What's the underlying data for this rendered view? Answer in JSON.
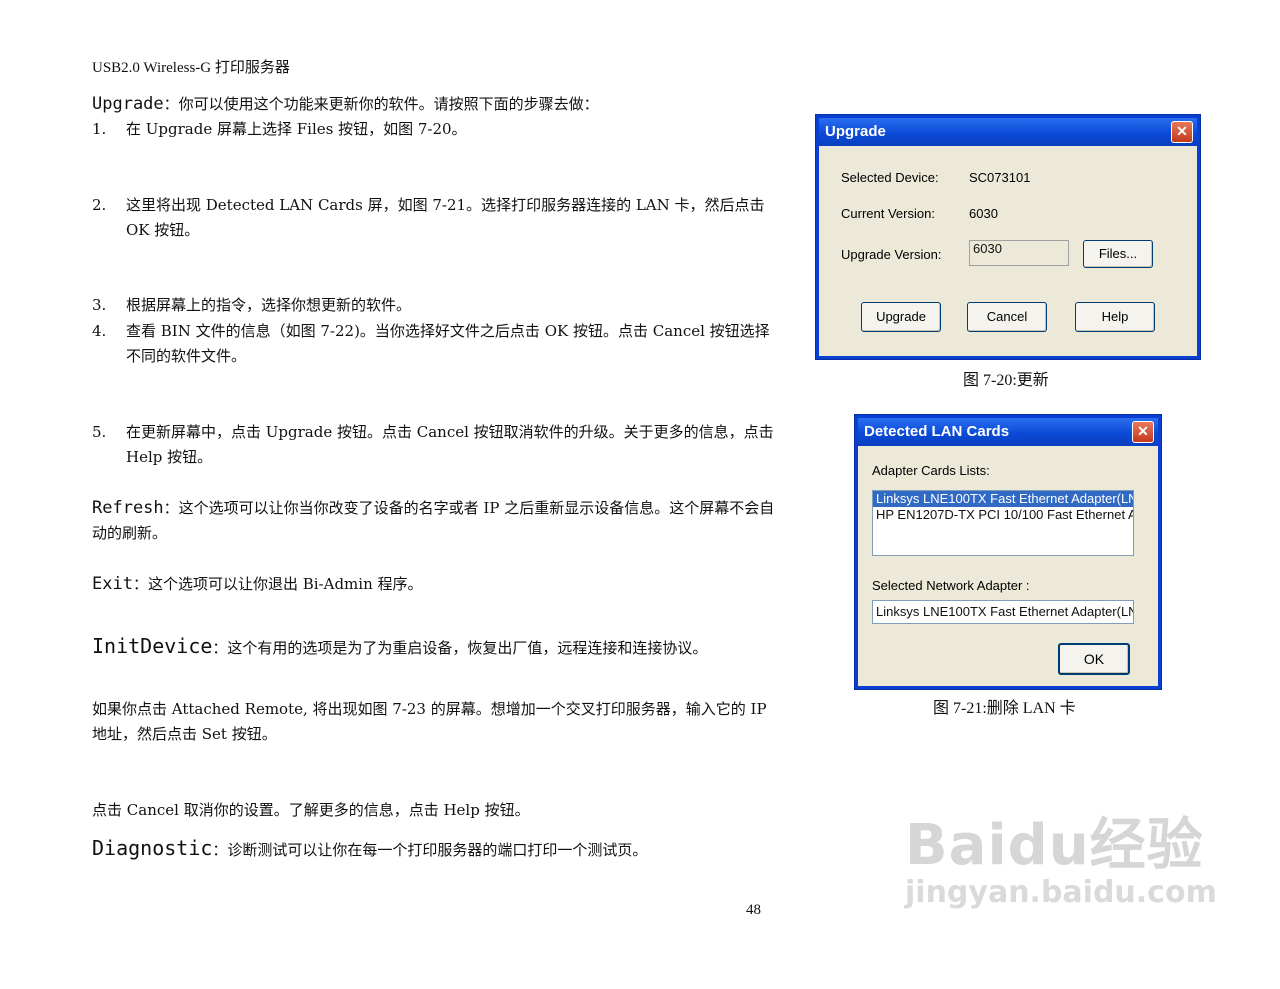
{
  "header": "USB2.0 Wireless-G 打印服务器",
  "upgrade": {
    "term": "Upgrade",
    "desc": "：你可以使用这个功能来更新你的软件。请按照下面的步骤去做：",
    "steps": [
      {
        "num": "1.",
        "text": "在 Upgrade 屏幕上选择 Files 按钮，如图 7-20。"
      },
      {
        "num": "2.",
        "text": "这里将出现 Detected LAN Cards 屏，如图 7-21。选择打印服务器连接的 LAN 卡，然后点击 OK 按钮。"
      },
      {
        "num": "3.",
        "text": "根据屏幕上的指令，选择你想更新的软件。"
      },
      {
        "num": "4.",
        "text": "查看 BIN 文件的信息（如图 7-22)。当你选择好文件之后点击 OK 按钮。点击 Cancel 按钮选择不同的软件文件。"
      },
      {
        "num": "5.",
        "text": "在更新屏幕中，点击 Upgrade 按钮。点击 Cancel 按钮取消软件的升级。关于更多的信息，点击 Help 按钮。"
      }
    ]
  },
  "refresh": {
    "term": "Refresh",
    "desc": "：这个选项可以让你当你改变了设备的名字或者 IP 之后重新显示设备信息。这个屏幕不会自动的刷新。"
  },
  "exit": {
    "term": "Exit",
    "desc": "：这个选项可以让你退出 Bi-Admin 程序。"
  },
  "initdevice": {
    "term": "InitDevice",
    "desc": "：这个有用的选项是为了为重启设备，恢复出厂值，远程连接和连接协议。"
  },
  "attached": "如果你点击 Attached Remote, 将出现如图 7-23 的屏幕。想增加一个交叉打印服务器，输入它的 IP 地址，然后点击 Set 按钮。",
  "cancel_note": "点击 Cancel 取消你的设置。了解更多的信息，点击 Help 按钮。",
  "diagnostic": {
    "term": "Diagnostic",
    "desc": "：诊断测试可以让你在每一个打印服务器的端口打印一个测试页。"
  },
  "page_number": "48",
  "dialog_upgrade": {
    "title": "Upgrade",
    "selected_device_label": "Selected Device:",
    "selected_device_value": "SC073101",
    "current_version_label": "Current Version:",
    "current_version_value": "6030",
    "upgrade_version_label": "Upgrade Version:",
    "upgrade_version_value": "6030",
    "files_button": "Files...",
    "upgrade_button": "Upgrade",
    "cancel_button": "Cancel",
    "help_button": "Help",
    "caption": "图 7-20:更新"
  },
  "dialog_lan": {
    "title": "Detected LAN Cards",
    "adapter_list_label": "Adapter Cards Lists:",
    "adapters": [
      "Linksys LNE100TX Fast Ethernet Adapter(LN",
      "HP EN1207D-TX PCI 10/100 Fast Ethernet A"
    ],
    "selected_label": "Selected Network Adapter :",
    "selected_value": "Linksys LNE100TX Fast Ethernet Adapter(LN",
    "ok_button": "OK",
    "caption": "图 7-21:删除 LAN 卡"
  },
  "watermark": {
    "brand": "Baidu经验",
    "url": "jingyan.baidu.com"
  }
}
